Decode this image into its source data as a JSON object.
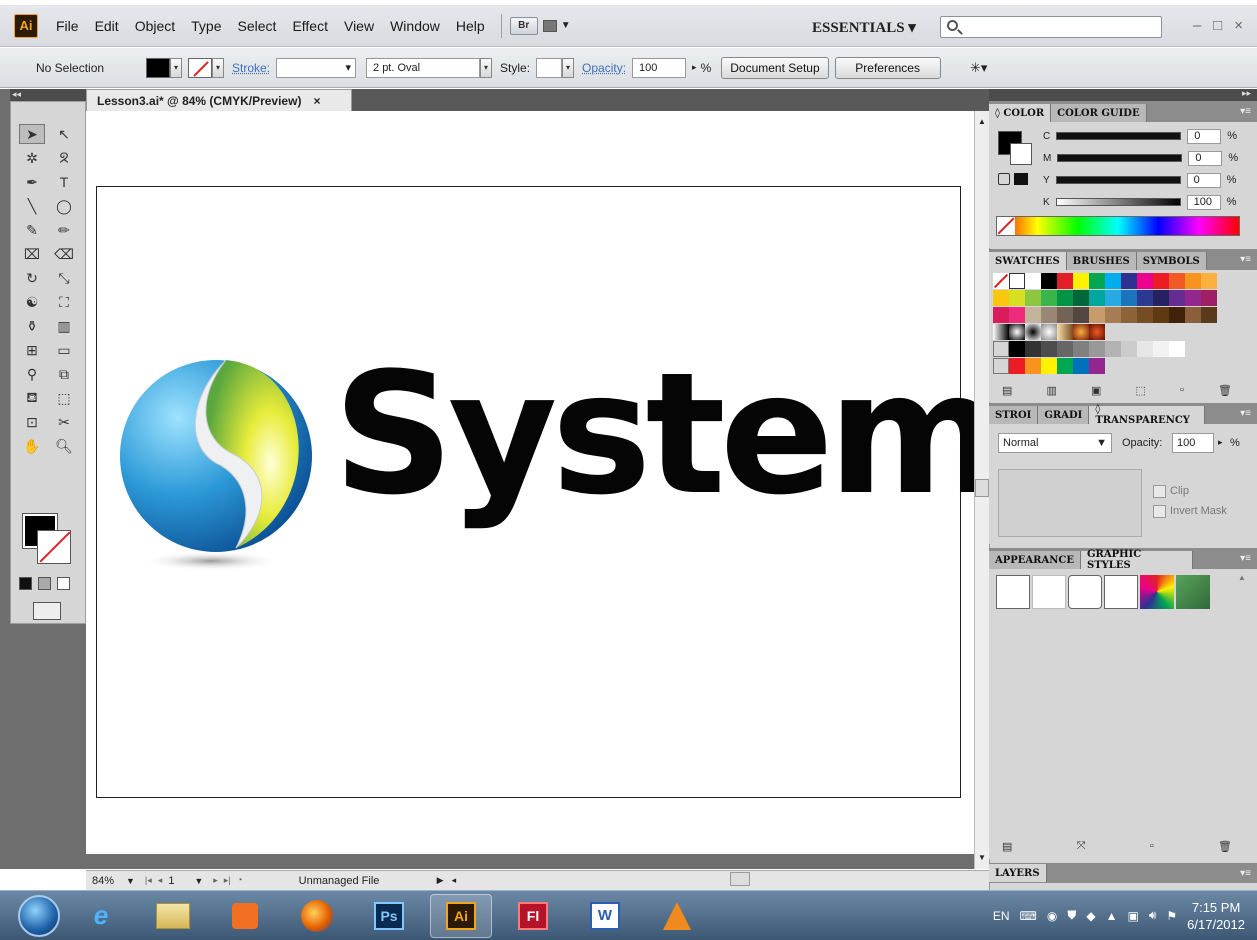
{
  "app": {
    "logo_text": "Ai",
    "menus": [
      "File",
      "Edit",
      "Object",
      "Type",
      "Select",
      "Effect",
      "View",
      "Window",
      "Help"
    ],
    "bridge_label": "Br",
    "workspace": "ESSENTIALS ▾",
    "window_controls": [
      "–",
      "□",
      "×"
    ]
  },
  "control_bar": {
    "selection": "No Selection",
    "stroke_label": "Stroke:",
    "brush": "2 pt. Oval",
    "style_label": "Style:",
    "opacity_label": "Opacity:",
    "opacity_value": "100",
    "pct": "%",
    "document_setup": "Document Setup",
    "preferences": "Preferences"
  },
  "document": {
    "tab_title": "Lesson3.ai* @ 84% (CMYK/Preview)",
    "close": "×",
    "logo_word": "System"
  },
  "status_bar": {
    "zoom": "84%",
    "page": "1",
    "status": "Unmanaged File"
  },
  "panels": {
    "color": {
      "tabs": [
        "◊ COLOR",
        "COLOR GUIDE"
      ],
      "channels": [
        {
          "label": "C",
          "value": "0",
          "pct": "%"
        },
        {
          "label": "M",
          "value": "0",
          "pct": "%"
        },
        {
          "label": "Y",
          "value": "0",
          "pct": "%"
        },
        {
          "label": "K",
          "value": "100",
          "pct": "%"
        }
      ]
    },
    "swatches": {
      "tabs": [
        "SWATCHES",
        "BRUSHES",
        "SYMBOLS"
      ]
    },
    "transparency": {
      "tabs": [
        "STROI",
        "GRADI",
        "◊ TRANSPARENCY"
      ],
      "blend_mode": "Normal",
      "opacity_label": "Opacity:",
      "opacity_value": "100",
      "pct": "%",
      "clip_label": "Clip",
      "invert_mask_label": "Invert Mask"
    },
    "appearance": {
      "tabs": [
        "APPEARANCE",
        "GRAPHIC STYLES"
      ]
    },
    "layers": {
      "title": "LAYERS"
    }
  },
  "taskbar": {
    "apps": [
      "IE",
      "Explorer",
      "Media",
      "Firefox",
      "Ps",
      "Ai",
      "Fl",
      "W",
      "VLC"
    ],
    "language": "EN",
    "time": "7:15 PM",
    "date": "6/17/2012"
  },
  "colors": {
    "accent_ai": "#f0a31c",
    "panel_bg": "#d6d6d6",
    "pasteboard": "#6e6e6e",
    "link_blue": "#3e6fb6"
  }
}
